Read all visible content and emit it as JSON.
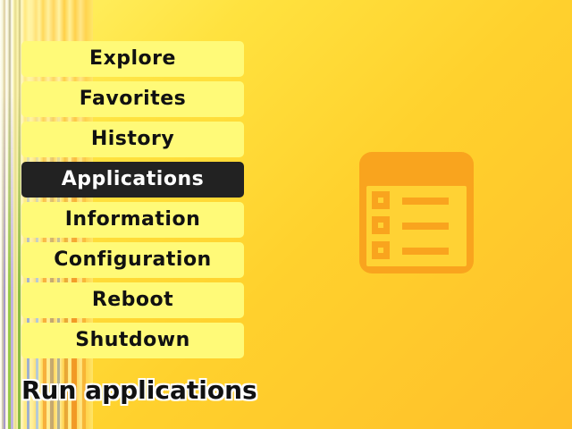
{
  "menu": {
    "items": [
      {
        "label": "Explore"
      },
      {
        "label": "Favorites"
      },
      {
        "label": "History"
      },
      {
        "label": "Applications",
        "selected": true
      },
      {
        "label": "Information"
      },
      {
        "label": "Configuration"
      },
      {
        "label": "Reboot"
      },
      {
        "label": "Shutdown"
      }
    ]
  },
  "status": {
    "description": "Run applications"
  },
  "preview": {
    "icon": "applications-list-icon"
  },
  "colors": {
    "menu_item_bg": "#fffa78",
    "menu_item_selected_bg": "#222222",
    "menu_item_selected_text": "#ffffff",
    "icon_color": "#f9a41e"
  }
}
